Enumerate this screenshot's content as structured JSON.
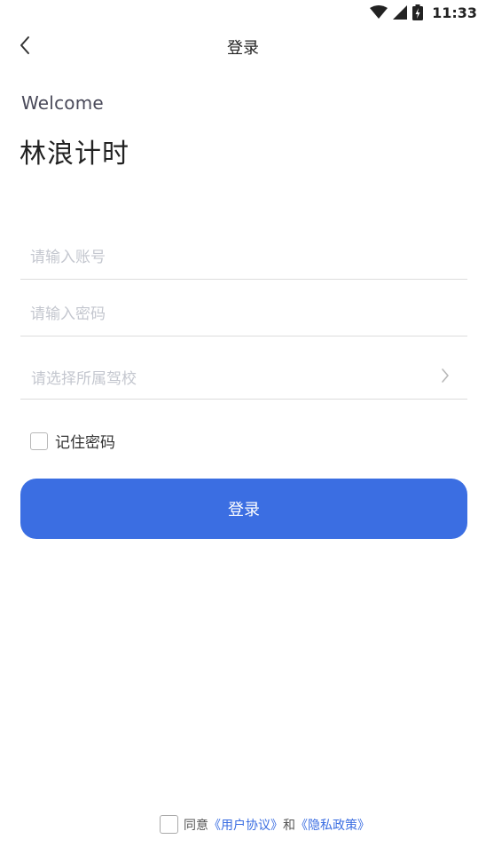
{
  "status_bar": {
    "time": "11:33",
    "icons": [
      "wifi-icon",
      "signal-icon",
      "battery-charging-icon"
    ]
  },
  "nav": {
    "title": "登录",
    "back_icon": "chevron-left-icon"
  },
  "header": {
    "welcome": "Welcome",
    "app_name": "林浪计时"
  },
  "form": {
    "account_placeholder": "请输入账号",
    "account_value": "",
    "password_placeholder": "请输入密码",
    "password_value": "",
    "school_placeholder": "请选择所属驾校",
    "school_icon": "chevron-right-icon",
    "remember_label": "记住密码",
    "remember_checked": false,
    "login_label": "登录"
  },
  "agreement": {
    "prefix": "同意",
    "user_agreement": "《用户协议》",
    "conjunction": "和",
    "privacy_policy": "《隐私政策》",
    "checked": false
  },
  "colors": {
    "accent": "#3b6ee2",
    "placeholder": "#c4c7cf"
  }
}
